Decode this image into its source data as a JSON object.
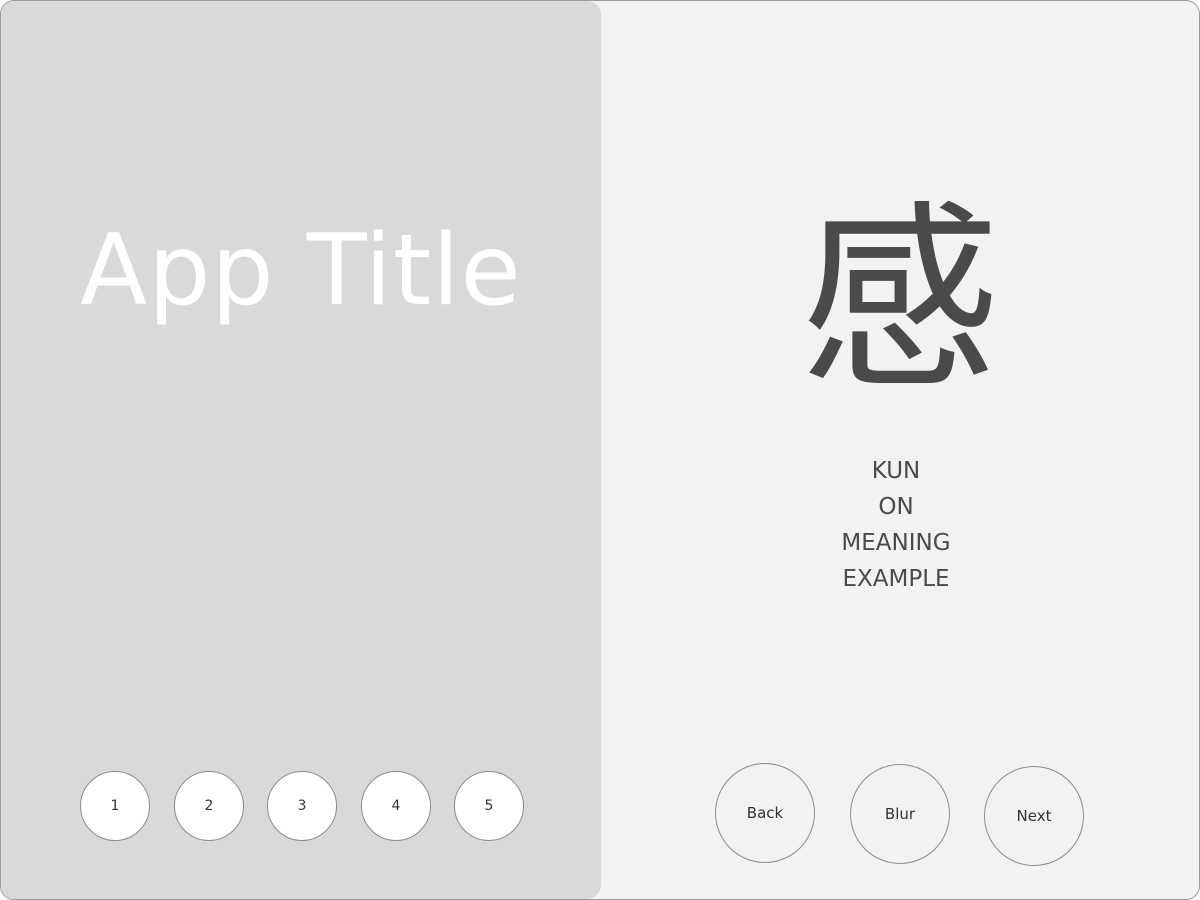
{
  "app": {
    "title": "App Title"
  },
  "level_buttons": [
    "1",
    "2",
    "3",
    "4",
    "5"
  ],
  "card": {
    "kanji": "感",
    "kun": "KUN",
    "on": "ON",
    "meaning": "MEANING",
    "example": "EXAMPLE"
  },
  "controls": {
    "back": "Back",
    "blur": "Blur",
    "next": "Next"
  }
}
